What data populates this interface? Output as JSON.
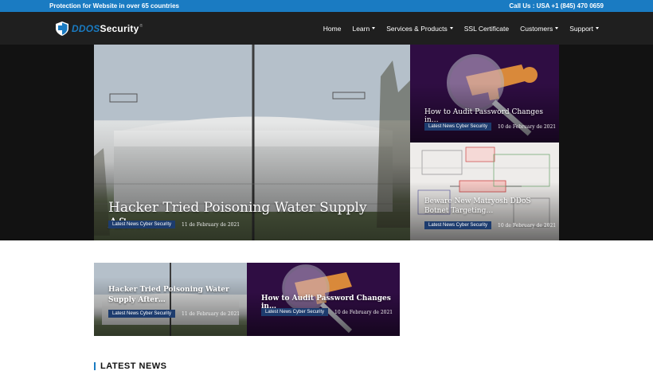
{
  "topbar": {
    "tagline": "Protection for Website in over 65 countries",
    "contact": "Call Us : USA +1 (845) 470 0659"
  },
  "brand": {
    "ddos": "DDOS",
    "security": "Security",
    "tm": "®"
  },
  "menu": [
    {
      "label": "Home",
      "dropdown": false
    },
    {
      "label": "Learn",
      "dropdown": true
    },
    {
      "label": "Services & Products",
      "dropdown": true
    },
    {
      "label": "SSL Certificate",
      "dropdown": false
    },
    {
      "label": "Customers",
      "dropdown": true
    },
    {
      "label": "Support",
      "dropdown": true
    }
  ],
  "featured": {
    "main": {
      "title": "Hacker Tried Poisoning Water Supply After…",
      "tag": "Latest News Cyber Security",
      "date": "11 de February de 2021"
    },
    "side_top": {
      "title": "How to Audit Password Changes in…",
      "tag": "Latest News Cyber Security",
      "date": "10 de February de 2021"
    },
    "side_bottom": {
      "title": "Beware New Matryosh DDoS Botnet Targeting…",
      "tag": "Latest News Cyber Security",
      "date": "10 de February de 2021"
    }
  },
  "secondary": [
    {
      "title": "Hacker Tried Poisoning Water Supply After…",
      "tag": "Latest News Cyber Security",
      "date": "11 de February de 2021"
    },
    {
      "title": "How to Audit Password Changes in…",
      "tag": "Latest News Cyber Security",
      "date": "10 de February de 2021"
    }
  ],
  "section": {
    "title": "LATEST NEWS"
  },
  "colors": {
    "topbar": "#1a7bc2",
    "nav": "#1f1f1f",
    "tag": "#1d3c6e"
  }
}
